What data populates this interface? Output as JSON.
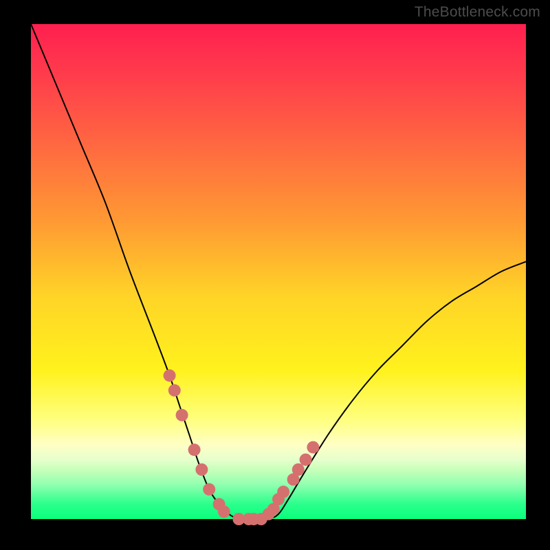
{
  "watermark": "TheBottleneck.com",
  "chart_data": {
    "type": "line",
    "title": "",
    "xlabel": "",
    "ylabel": "",
    "xlim": [
      0,
      100
    ],
    "ylim": [
      0,
      100
    ],
    "grid": false,
    "series": [
      {
        "name": "bottleneck-curve",
        "x": [
          0,
          5,
          10,
          15,
          20,
          25,
          28,
          30,
          32,
          34,
          36,
          38,
          40,
          42,
          44,
          46,
          48,
          50,
          52,
          55,
          60,
          65,
          70,
          75,
          80,
          85,
          90,
          95,
          100
        ],
        "y": [
          100,
          88,
          76,
          64,
          50,
          37,
          29,
          23,
          17,
          11,
          6,
          3,
          1,
          0,
          0,
          0,
          0,
          1,
          4,
          9,
          17,
          24,
          30,
          35,
          40,
          44,
          47,
          50,
          52
        ],
        "color": "#000000"
      }
    ],
    "markers": {
      "name": "highlight-points",
      "x": [
        28,
        29,
        30.5,
        33,
        34.5,
        36,
        38,
        39,
        42,
        44,
        45,
        46.5,
        48,
        49,
        50,
        51,
        53,
        54,
        55.5,
        57
      ],
      "y": [
        29,
        26,
        21,
        14,
        10,
        6,
        3,
        1.5,
        0,
        0,
        0,
        0,
        1,
        2,
        4,
        5.5,
        8,
        10,
        12,
        14.5
      ],
      "color": "#d4716f",
      "radius_px": 9
    },
    "background_gradient": [
      {
        "stop": 0.0,
        "color": "#ff1f4f"
      },
      {
        "stop": 0.55,
        "color": "#ffd427"
      },
      {
        "stop": 0.85,
        "color": "#ffffc4"
      },
      {
        "stop": 1.0,
        "color": "#0aff7c"
      }
    ]
  }
}
